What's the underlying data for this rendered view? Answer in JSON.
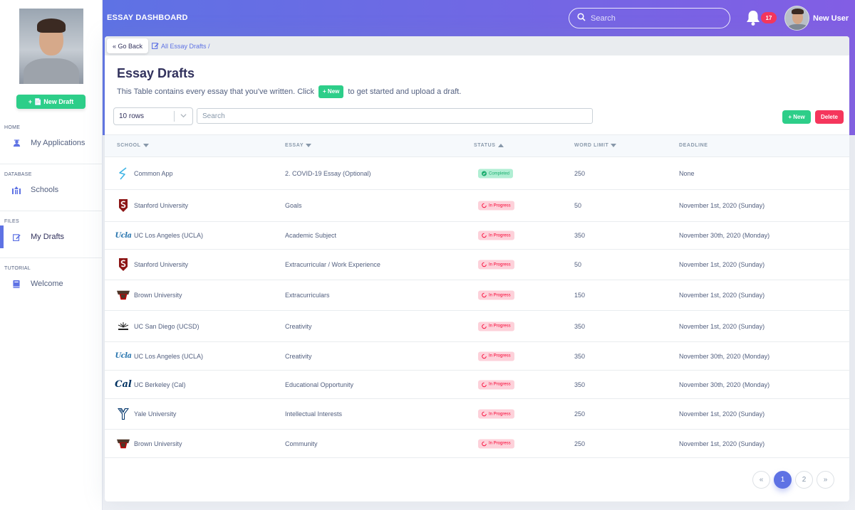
{
  "app": {
    "title": "ESSAY DASHBOARD"
  },
  "header": {
    "search_placeholder": "Search",
    "notification_count": "17",
    "user_name": "New User"
  },
  "sidebar": {
    "new_draft_label": "+ 📄 New Draft",
    "sections": [
      {
        "title": "HOME",
        "item": "My Applications",
        "icon": "user-graduate-icon"
      },
      {
        "title": "DATABASE",
        "item": "Schools",
        "icon": "university-icon"
      },
      {
        "title": "FILES",
        "item": "My Drafts",
        "icon": "edit-icon",
        "active": true
      },
      {
        "title": "TUTORIAL",
        "item": "Welcome",
        "icon": "book-icon"
      }
    ]
  },
  "breadcrumb": {
    "back_label": "« Go Back",
    "path": "All Essay Drafts /"
  },
  "page": {
    "title": "Essay Drafts",
    "subtitle_before": "This Table contains every essay that you've written. Click",
    "subtitle_new": "+ New",
    "subtitle_after": "to get started and upload a draft."
  },
  "controls": {
    "rows_selected": "10 rows",
    "search_placeholder": "Search",
    "new_label": "+ New",
    "delete_label": "Delete"
  },
  "table": {
    "columns": [
      "SCHOOL",
      "ESSAY",
      "STATUS",
      "WORD LIMIT",
      "DEADLINE"
    ],
    "rows": [
      {
        "school": "Common App",
        "logo": "common-app-logo",
        "essay": "2. COVID-19 Essay (Optional)",
        "status": "Completed",
        "limit": "250",
        "deadline": "None"
      },
      {
        "school": "Stanford University",
        "logo": "stanford-logo",
        "essay": "Goals",
        "status": "In Progress",
        "limit": "50",
        "deadline": "November 1st, 2020 (Sunday)"
      },
      {
        "school": "UC Los Angeles (UCLA)",
        "logo": "ucla-logo",
        "essay": "Academic Subject",
        "status": "In Progress",
        "limit": "350",
        "deadline": "November 30th, 2020 (Monday)"
      },
      {
        "school": "Stanford University",
        "logo": "stanford-logo",
        "essay": "Extracurricular / Work Experience",
        "status": "In Progress",
        "limit": "50",
        "deadline": "November 1st, 2020 (Sunday)"
      },
      {
        "school": "Brown University",
        "logo": "brown-logo",
        "essay": "Extracurriculars",
        "status": "In Progress",
        "limit": "150",
        "deadline": "November 1st, 2020 (Sunday)"
      },
      {
        "school": "UC San Diego (UCSD)",
        "logo": "ucsd-logo",
        "essay": "Creativity",
        "status": "In Progress",
        "limit": "350",
        "deadline": "November 1st, 2020 (Sunday)"
      },
      {
        "school": "UC Los Angeles (UCLA)",
        "logo": "ucla-logo",
        "essay": "Creativity",
        "status": "In Progress",
        "limit": "350",
        "deadline": "November 30th, 2020 (Monday)"
      },
      {
        "school": "UC Berkeley (Cal)",
        "logo": "cal-logo",
        "essay": "Educational Opportunity",
        "status": "In Progress",
        "limit": "350",
        "deadline": "November 30th, 2020 (Monday)"
      },
      {
        "school": "Yale University",
        "logo": "yale-logo",
        "essay": "Intellectual Interests",
        "status": "In Progress",
        "limit": "250",
        "deadline": "November 1st, 2020 (Sunday)"
      },
      {
        "school": "Brown University",
        "logo": "brown-logo",
        "essay": "Community",
        "status": "In Progress",
        "limit": "250",
        "deadline": "November 1st, 2020 (Sunday)"
      }
    ]
  },
  "pagination": {
    "prev": "«",
    "pages": [
      "1",
      "2"
    ],
    "current": "1",
    "next": "»"
  },
  "colors": {
    "primary": "#5e72e4",
    "success": "#2dce89",
    "danger": "#f5365c"
  }
}
